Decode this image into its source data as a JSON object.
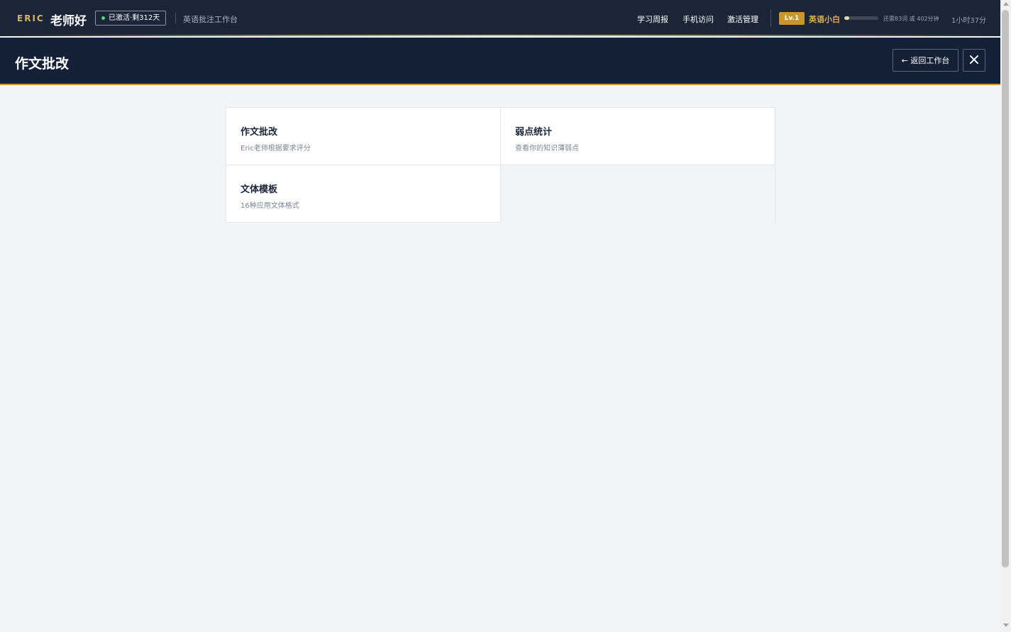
{
  "topbar": {
    "brand_en": "ERIC",
    "brand_cn": "老师好",
    "status": "已激活·剩312天",
    "subtitle": "英语批注工作台",
    "links": [
      "学习周报",
      "手机访问",
      "激活管理"
    ],
    "level_badge": "Lv.1",
    "level_name": "英语小白",
    "xp_progress": 0.15,
    "xp_remaining": "还需83词 或 402分钟",
    "time": "1小时37分"
  },
  "header": {
    "title": "作文批改",
    "back_label": "← 返回工作台",
    "close_label": "×"
  },
  "cards": [
    {
      "title": "作文批改",
      "desc": "Eric老师根据要求评分"
    },
    {
      "title": "弱点统计",
      "desc": "查看你的知识薄弱点"
    },
    {
      "title": "文体模板",
      "desc": "16种应用文体格式"
    }
  ],
  "colors": {
    "nav_bg": "#1a2538",
    "header_bg": "#142036",
    "accent_gold": "#c9962e",
    "status_green": "#4ade80"
  },
  "icons": {
    "status": "active-dot-icon",
    "close": "close-icon"
  }
}
